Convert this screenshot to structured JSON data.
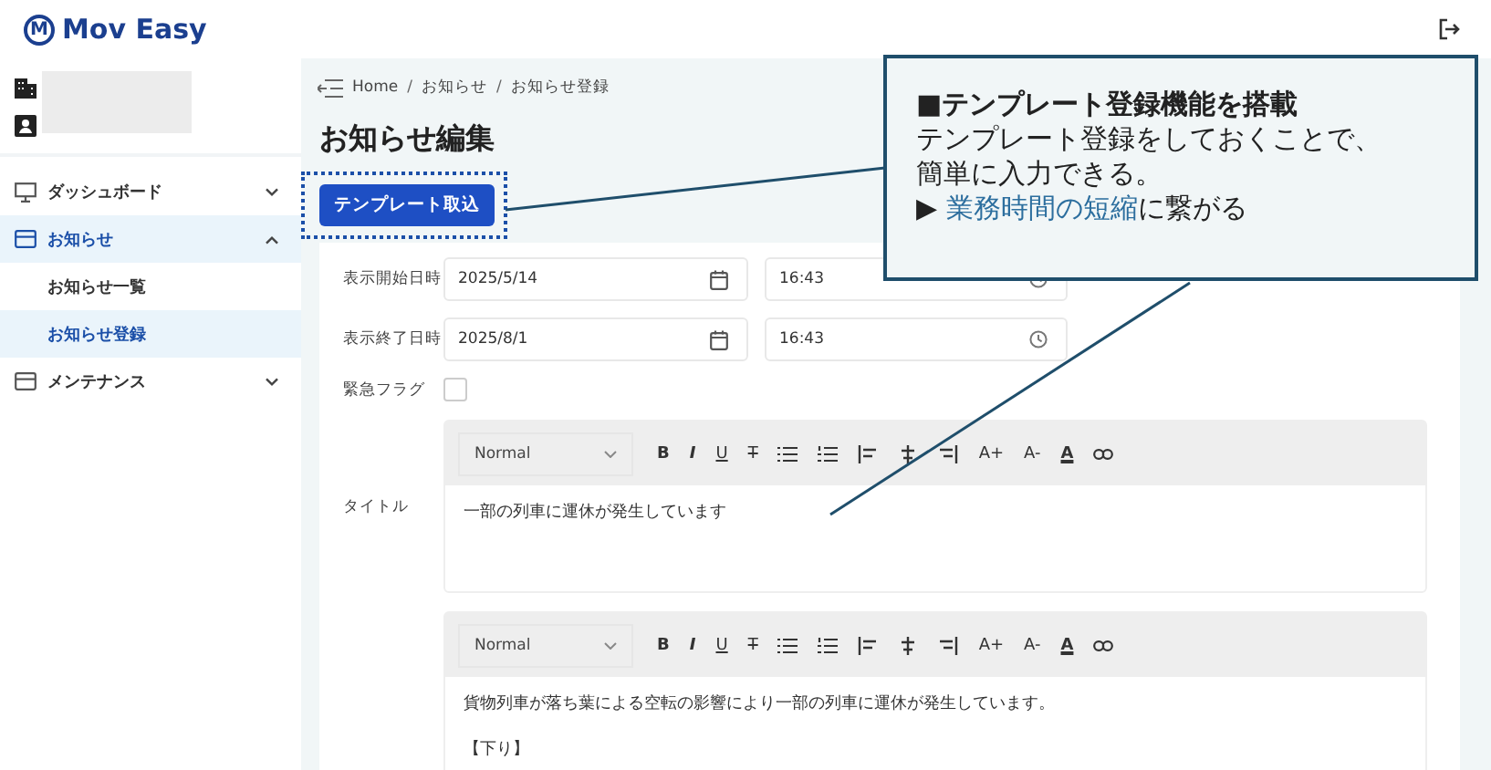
{
  "header": {
    "logo_mark": "M",
    "logo_text": "Mov Easy"
  },
  "sidebar": {
    "items": [
      {
        "label": "ダッシュボード",
        "selected": false,
        "expanded": false
      },
      {
        "label": "お知らせ",
        "selected": true,
        "expanded": true,
        "children": [
          {
            "label": "お知らせ一覧",
            "selected": false
          },
          {
            "label": "お知らせ登録",
            "selected": true
          }
        ]
      },
      {
        "label": "メンテナンス",
        "selected": false,
        "expanded": false
      }
    ]
  },
  "breadcrumb": [
    "Home",
    "/",
    "お知らせ",
    "/",
    "お知らせ登録"
  ],
  "page_title": "お知らせ編集",
  "template_button": "テンプレート取込",
  "form": {
    "date_rows": [
      {
        "label": "表示開始日時",
        "date": "2025/5/14",
        "time": "16:43"
      },
      {
        "label": "表示終了日時",
        "date": "2025/8/1",
        "time": "16:43"
      }
    ],
    "urgent": {
      "label": "緊急フラグ",
      "checked": false
    },
    "editors": [
      {
        "label": "タイトル",
        "select": "Normal",
        "toolbar": [
          {
            "kind": "bold",
            "label": "B"
          },
          {
            "kind": "italic",
            "label": "I"
          },
          {
            "kind": "underline",
            "label": "U"
          },
          {
            "kind": "strike",
            "label": "T"
          },
          {
            "kind": "bullets"
          },
          {
            "kind": "numbers"
          },
          {
            "kind": "left"
          },
          {
            "kind": "center"
          },
          {
            "kind": "right"
          },
          {
            "kind": "plain",
            "label": "A+"
          },
          {
            "kind": "plain",
            "label": "A-"
          },
          {
            "kind": "color",
            "label": "A"
          },
          {
            "kind": "link"
          }
        ],
        "paragraphs": [
          "一部の列車に運休が発生しています"
        ]
      },
      {
        "select": "Normal",
        "toolbar": [
          {
            "kind": "bold",
            "label": "B"
          },
          {
            "kind": "italic",
            "label": "I"
          },
          {
            "kind": "underline",
            "label": "U"
          },
          {
            "kind": "strike",
            "label": "T"
          },
          {
            "kind": "bullets"
          },
          {
            "kind": "numbers"
          },
          {
            "kind": "left"
          },
          {
            "kind": "center"
          },
          {
            "kind": "right"
          },
          {
            "kind": "plain",
            "label": "A+"
          },
          {
            "kind": "plain",
            "label": "A-"
          },
          {
            "kind": "color",
            "label": "A"
          },
          {
            "kind": "link"
          }
        ],
        "paragraphs": [
          "貨物列車が落ち葉による空転の影響により一部の列車に運休が発生しています。",
          "【下り】"
        ]
      }
    ]
  },
  "callout": {
    "title": "■テンプレート登録機能を搭載",
    "lines": [
      "テンプレート登録をしておくことで、",
      "簡単に入力できる。"
    ],
    "conclusion": [
      {
        "text": "▶ ",
        "highlight": false
      },
      {
        "text": "業務時間の短縮",
        "highlight": true
      },
      {
        "text": "に繋がる",
        "highlight": false
      }
    ]
  }
}
